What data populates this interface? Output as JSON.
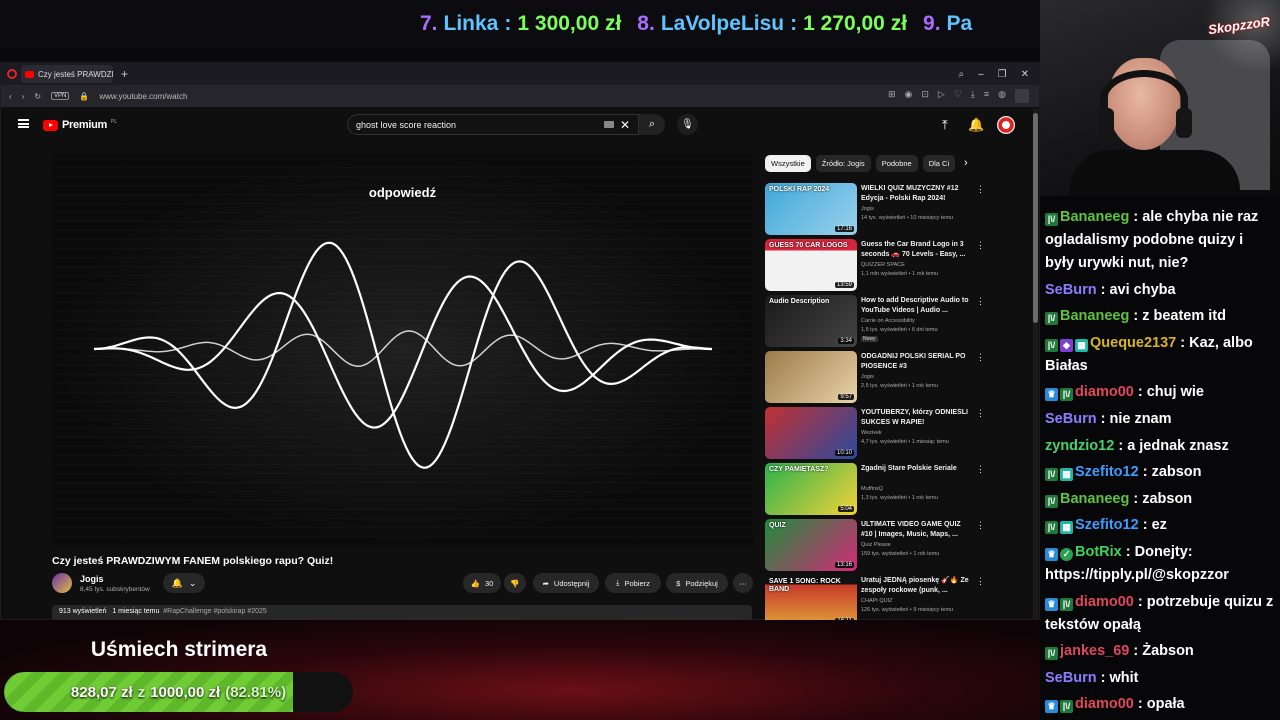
{
  "ticker": [
    {
      "rank": "7.",
      "name": "Linka",
      "amount": "1 300,00 zł"
    },
    {
      "rank": "8.",
      "name": "LaVolpeLisu",
      "amount": "1 270,00 zł"
    },
    {
      "rank": "9.",
      "name": "Pa",
      "amount": ""
    }
  ],
  "browser": {
    "tab_title": "Czy jesteś PRAWDZIWY",
    "url": "www.youtube.com/watch",
    "vpn_label": "VPN"
  },
  "youtube": {
    "brand": "Premium",
    "brand_suffix": "PL",
    "search_value": "ghost love score reaction"
  },
  "video": {
    "overlay_word": "odpowiedź",
    "title": "Czy jesteś PRAWDZIWYM FANEM polskiego rapu? Quiz!",
    "channel": "Jogis",
    "subscribers": "8,45 tys. subskrybentów",
    "likes": "30",
    "share": "Udostępnij",
    "download": "Pobierz",
    "thanks": "Podziękuj",
    "views": "913 wyświetleń",
    "age": "1 miesiąc temu",
    "tags": "#RapChallenge #polskirap #2025"
  },
  "chips": [
    "Wszystkie",
    "Źródło: Jogis",
    "Podobne",
    "Dla Ci"
  ],
  "recommendations": [
    {
      "title": "WIELKI QUIZ MUZYCZNY #12 Edycja - Polski Rap 2024!",
      "channel": "Jogis",
      "meta": "14 tys. wyświetleń • 10 miesięcy temu",
      "duration": "17:16",
      "thumb_text": "POLSKI RAP 2024",
      "badge": ""
    },
    {
      "title": "Guess the Car Brand Logo in 3 seconds 🚗 70 Levels - Easy, ...",
      "channel": "QUIZZER SPACE",
      "meta": "1,1 mln wyświetleń • 1 rok temu",
      "duration": "13:59",
      "thumb_text": "GUESS 70 CAR LOGOS",
      "badge": ""
    },
    {
      "title": "How to add Descriptive Audio to YouTube Videos | Audio ...",
      "channel": "Carrie on Accessibility",
      "meta": "1,5 tys. wyświetleń • 6 dni temu",
      "duration": "3:34",
      "thumb_text": "Audio Description",
      "badge": "Nowy"
    },
    {
      "title": "ODGADNIJ POLSKI SERIAL PO PIOSENCE #3",
      "channel": "Jogis",
      "meta": "2,5 tys. wyświetleń • 1 rok temu",
      "duration": "9:57",
      "thumb_text": "",
      "badge": ""
    },
    {
      "title": "YOUTUBERZY, którzy ODNIEŚLI SUKCES W RAPIE!",
      "channel": "Wezivek",
      "meta": "4,7 tys. wyświetleń • 1 miesiąc temu",
      "duration": "10:10",
      "thumb_text": "",
      "badge": ""
    },
    {
      "title": "Zgadnij Stare Polskie Seriale",
      "channel": "MuffinsQ",
      "meta": "1,3 tys. wyświetleń • 1 rok temu",
      "duration": "5:04",
      "thumb_text": "CZY PAMIĘTASZ?",
      "badge": ""
    },
    {
      "title": "ULTIMATE VIDEO GAME QUIZ #10 | Images, Music, Maps, ...",
      "channel": "Quiz Please",
      "meta": "159 tys. wyświetleń • 1 rok temu",
      "duration": "13:16",
      "thumb_text": "QUIZ",
      "badge": ""
    },
    {
      "title": "Uratuj JEDNĄ piosenkę 🎸🔥 Ze zespoły rockowe (punk, ...",
      "channel": "CHAPI QUIZ",
      "meta": "126 tys. wyświetleń • 9 miesięcy temu",
      "duration": "16:11",
      "thumb_text": "SAVE 1 SONG: ROCK BAND",
      "badge": ""
    }
  ],
  "webcam": {
    "logo": "SkopzzoR"
  },
  "chat": [
    {
      "badges": [
        "vip"
      ],
      "user": "Bananeeg",
      "color": "#5fc43b",
      "text": "ale chyba nie raz ogladalismy podobne quizy i były urywki nut, nie?"
    },
    {
      "badges": [],
      "user": "SeBurn",
      "color": "#8c7cff",
      "text": "avi chyba"
    },
    {
      "badges": [
        "vip"
      ],
      "user": "Bananeeg",
      "color": "#5fc43b",
      "text": "z beatem itd"
    },
    {
      "badges": [
        "vip",
        "purple",
        "sub"
      ],
      "user": "Queque2137",
      "color": "#d7b422",
      "text": "Kaz, albo Białas"
    },
    {
      "badges": [
        "prime",
        "vip"
      ],
      "user": "diamo00",
      "color": "#e0465c",
      "text": "chuj wie"
    },
    {
      "badges": [],
      "user": "SeBurn",
      "color": "#8c7cff",
      "text": "nie znam"
    },
    {
      "badges": [],
      "user": "zyndzio12",
      "color": "#48d36a",
      "text": "a jednak znasz"
    },
    {
      "badges": [
        "vip",
        "sub"
      ],
      "user": "Szefito12",
      "color": "#3f9dff",
      "text": "zabson"
    },
    {
      "badges": [
        "vip"
      ],
      "user": "Bananeeg",
      "color": "#5fc43b",
      "text": "zabson"
    },
    {
      "badges": [
        "vip",
        "sub"
      ],
      "user": "Szefito12",
      "color": "#3f9dff",
      "text": "ez"
    },
    {
      "badges": [
        "prime",
        "bot"
      ],
      "user": "BotRix",
      "color": "#3fd35e",
      "text": "Donejty: https://tipply.pl/@skopzzor"
    },
    {
      "badges": [
        "prime",
        "vip"
      ],
      "user": "diamo00",
      "color": "#e0465c",
      "text": "potrzebuje quizu z tekstów opałą"
    },
    {
      "badges": [
        "vip"
      ],
      "user": "jankes_69",
      "color": "#d9485e",
      "text": "Żabson"
    },
    {
      "badges": [],
      "user": "SeBurn",
      "color": "#8c7cff",
      "text": "whit"
    },
    {
      "badges": [
        "prime",
        "vip"
      ],
      "user": "diamo00",
      "color": "#e0465c",
      "text": "opała"
    }
  ],
  "goal": {
    "title": "Uśmiech strimera",
    "current": "828,07 zł",
    "separator": "z",
    "target": "1000,00 zł",
    "percent_label": "(82.81%)",
    "fraction": 0.8281
  }
}
